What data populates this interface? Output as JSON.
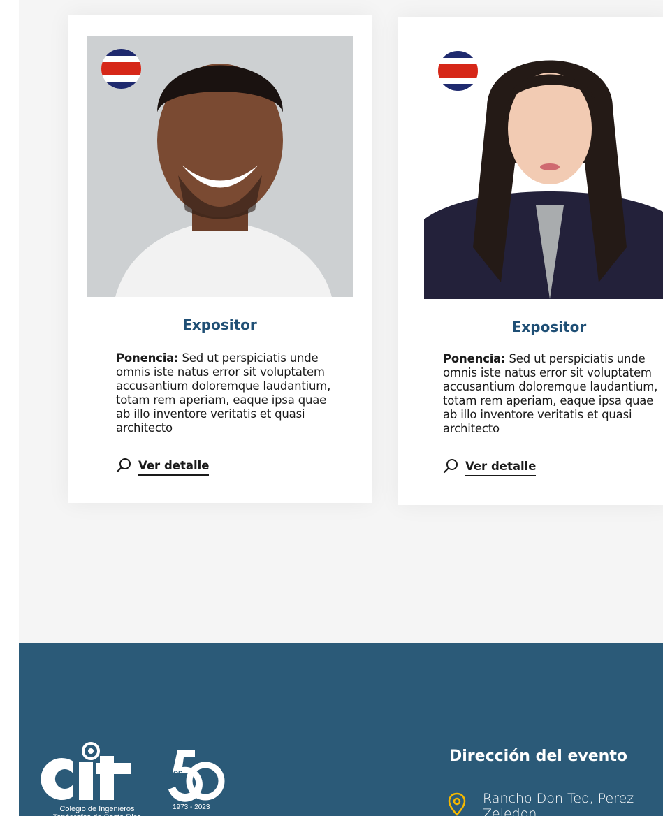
{
  "speakers": [
    {
      "role": "Expositor",
      "talk_label": "Ponencia:",
      "talk_text": "Sed ut perspiciatis unde omnis iste natus error sit voluptatem accusantium doloremque laudantium, totam rem aperiam, eaque ipsa quae ab illo inventore veritatis et quasi architecto",
      "detail_link": "Ver detalle",
      "flag": "costa-rica-flag-icon"
    },
    {
      "role": "Expositor",
      "talk_label": "Ponencia:",
      "talk_text": "Sed ut perspiciatis unde omnis iste natus error sit voluptatem accusantium doloremque laudantium, totam rem aperiam, eaque ipsa quae ab illo inventore veritatis et quasi architecto",
      "detail_link": "Ver detalle",
      "flag": "costa-rica-flag-icon"
    }
  ],
  "footer": {
    "logo": {
      "brand": "cit",
      "anniversary_small": "AÑOS",
      "years": "1973 - 2023",
      "caption": "Colegio de Ingenieros Topógrafos de Costa Rica"
    },
    "event_title": "Dirección del evento",
    "address": "Rancho Don Teo, Perez Zeledon",
    "address_icon": "location-pin-icon"
  },
  "colors": {
    "accent": "#1f4f75",
    "footer_bg": "#2b5a78",
    "pin": "#f5b800"
  }
}
